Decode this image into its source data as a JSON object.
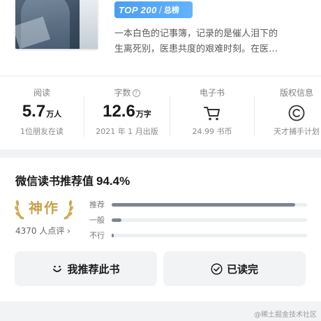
{
  "book": {
    "badge_top": "TOP 200",
    "badge_separator": "/",
    "badge_category": "总榜",
    "intro_line1": "一本白色的记事簿，记录的是催人泪下的",
    "intro_line2": "生离死别，医患共度的艰难时刻。在医…"
  },
  "stats": {
    "reads": {
      "label": "阅读",
      "value": "5.7",
      "unit": "万人",
      "sub": "1位朋友在读"
    },
    "words": {
      "label": "字数",
      "value": "12.6",
      "unit": "万字",
      "sub": "2021 年 1 月出版"
    },
    "ebook": {
      "label": "电子书",
      "sub": "24.99 书币",
      "icon": "cart-icon"
    },
    "copyright": {
      "label": "版权信息",
      "sub": "天才捕手计划",
      "icon": "copyright-icon"
    }
  },
  "recommend": {
    "title": "微信读书推荐值",
    "percent": "94.4%",
    "rating_label": "神作",
    "raters": "4370 人点评",
    "bars": [
      {
        "label": "推荐",
        "fraction": 0.94
      },
      {
        "label": "一般",
        "fraction": 0.05
      },
      {
        "label": "不行",
        "fraction": 0.01
      }
    ],
    "recommend_button": "我推荐此书",
    "read_button": "已读完"
  },
  "colors": {
    "badge_blue": "#4a9df2",
    "gold": "#c8a04c",
    "bar_fill": "#7d8591"
  },
  "watermark": "@稀土掘金技术社区"
}
